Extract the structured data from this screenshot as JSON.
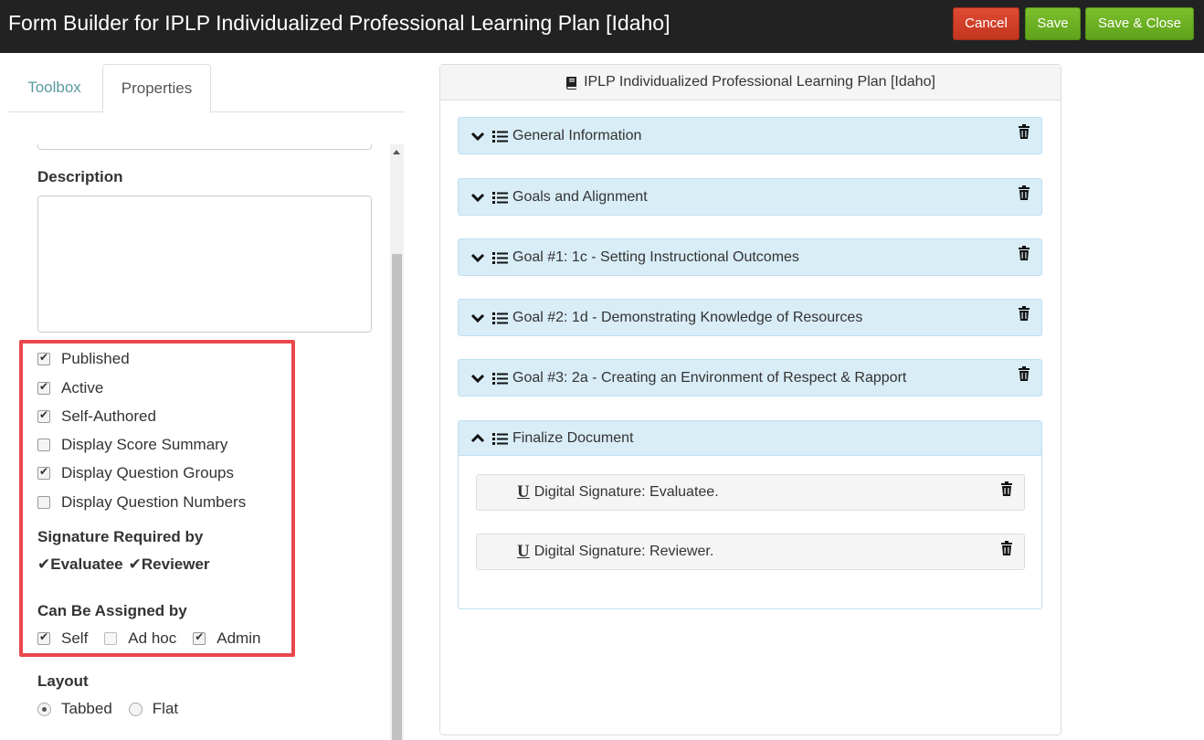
{
  "header": {
    "title": "Form Builder for IPLP Individualized Professional Learning Plan [Idaho]",
    "cancel_label": "Cancel",
    "save_label": "Save",
    "save_close_label": "Save & Close",
    "cancel_color": "#d0402a",
    "save_color": "#6cb024"
  },
  "left_panel": {
    "tabs": [
      {
        "label": "Toolbox",
        "active": false
      },
      {
        "label": "Properties",
        "active": true
      }
    ],
    "description_label": "Description",
    "checkboxes": [
      {
        "label": "Published",
        "checked": true
      },
      {
        "label": "Active",
        "checked": true
      },
      {
        "label": "Self-Authored",
        "checked": true
      },
      {
        "label": "Display Score Summary",
        "checked": false
      },
      {
        "label": "Display Question Groups",
        "checked": true
      },
      {
        "label": "Display Question Numbers",
        "checked": false
      }
    ],
    "signature_required_label": "Signature Required by",
    "signature_required": [
      "Evaluatee",
      "Reviewer"
    ],
    "assigned_label": "Can Be Assigned by",
    "assigned_options": [
      {
        "label": "Self",
        "checked": true
      },
      {
        "label": "Ad hoc",
        "checked": false
      },
      {
        "label": "Admin",
        "checked": true
      }
    ],
    "layout_label": "Layout",
    "layout_options": [
      {
        "label": "Tabbed",
        "selected": true
      },
      {
        "label": "Flat",
        "selected": false
      }
    ],
    "highlight_color": "#e9474d"
  },
  "form": {
    "title": "IPLP Individualized Professional Learning Plan [Idaho]",
    "sections": [
      {
        "label": "General Information",
        "expanded": false
      },
      {
        "label": "Goals and Alignment",
        "expanded": false
      },
      {
        "label": "Goal #1: 1c - Setting Instructional Outcomes",
        "expanded": false
      },
      {
        "label": "Goal #2: 1d - Demonstrating Knowledge of Resources",
        "expanded": false
      },
      {
        "label": "Goal #3: 2a - Creating an Environment of Respect & Rapport",
        "expanded": false
      }
    ],
    "final_section": {
      "label": "Finalize Document",
      "expanded": true,
      "items": [
        {
          "icon": "U",
          "label": "Digital Signature: Evaluatee."
        },
        {
          "icon": "U",
          "label": "Digital Signature: Reviewer."
        }
      ]
    },
    "section_color": "#d9edf7"
  }
}
